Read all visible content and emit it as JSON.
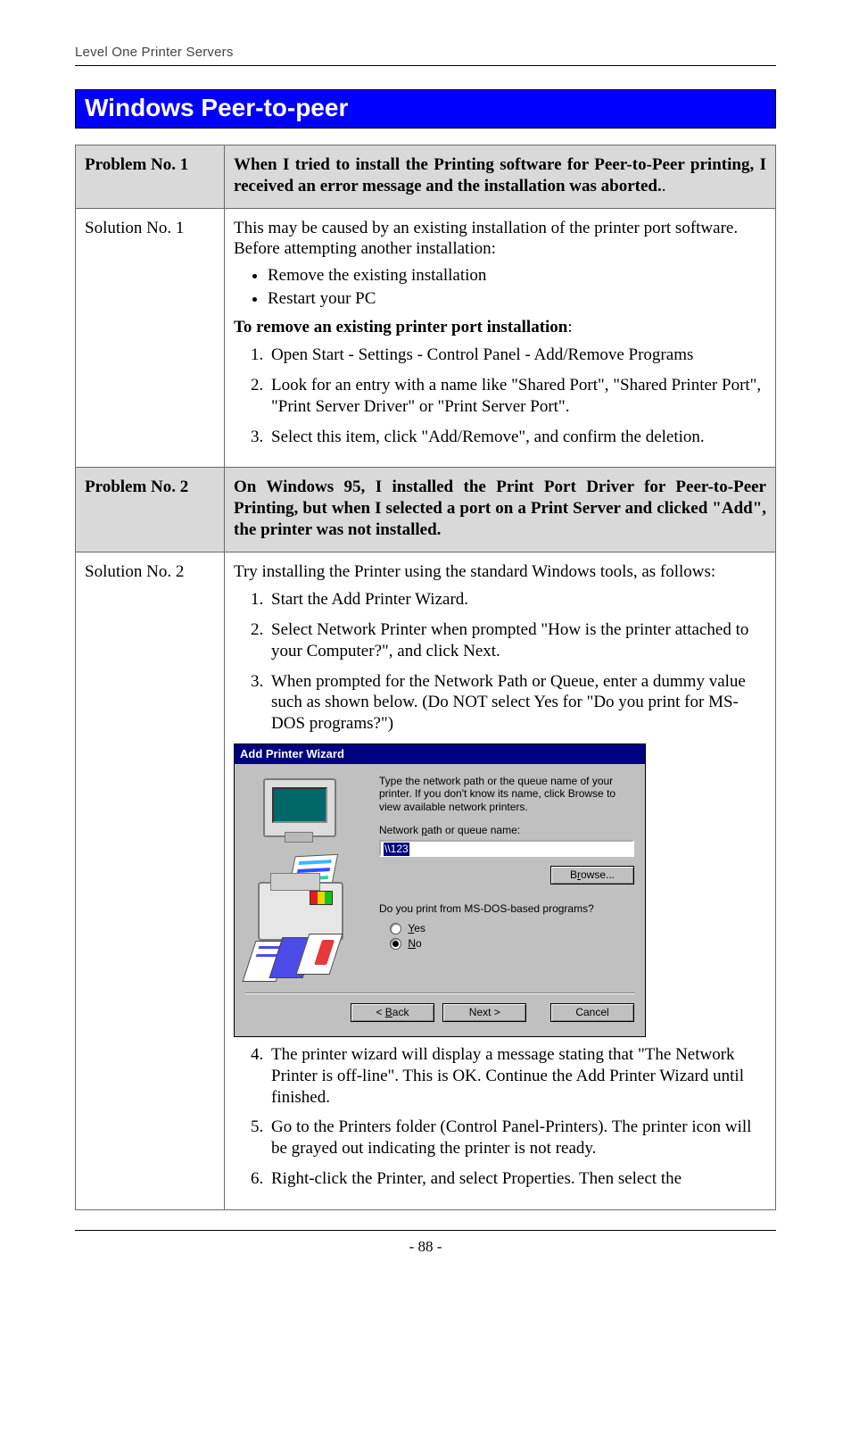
{
  "header": {
    "running": "Level One Printer Servers"
  },
  "section": {
    "title": "Windows Peer-to-peer"
  },
  "rows": {
    "p1": {
      "label": "Problem No. 1",
      "text_a": "When I tried to install the Printing software for Peer-to-Peer printing, I received an error message and the installation was aborted.",
      "text_b": "."
    },
    "s1": {
      "label": "Solution No. 1",
      "intro": "This may be caused by an existing installation of the printer port software. Before attempting another installation:",
      "bullets": [
        "Remove the existing installation",
        "Restart your PC"
      ],
      "subhead_a": "To remove an existing printer port installation",
      "subhead_b": ":",
      "steps": [
        "Open Start - Settings - Control Panel - Add/Remove Programs",
        "Look for an entry with a name like \"Shared Port\", \"Shared Printer Port\", \"Print Server Driver\" or \"Print Server Port\".",
        "Select this item, click \"Add/Remove\", and confirm the deletion."
      ]
    },
    "p2": {
      "label": "Problem No. 2",
      "text": "On Windows 95, I installed the Print Port Driver for Peer-to-Peer Printing, but when I selected a port on a Print Server and clicked \"Add\", the printer was not installed."
    },
    "s2": {
      "label": "Solution No. 2",
      "intro": "Try installing the Printer using the standard Windows tools, as follows:",
      "steps_before": [
        "Start the Add Printer Wizard.",
        "Select Network Printer when prompted \"How is the printer attached to your Computer?\", and click Next.",
        "When prompted for the Network Path or Queue, enter a dummy value such as shown below. (Do NOT select Yes for \"Do you print for MS-DOS programs?\")"
      ],
      "steps_after": [
        "The printer wizard will display a message stating that \"The Network Printer is off-line\". This is OK. Continue the Add Printer Wizard until finished.",
        "Go to the Printers folder (Control Panel-Printers). The printer icon will be grayed out indicating the printer is not ready.",
        "Right-click the Printer, and select Properties. Then select the"
      ]
    }
  },
  "dialog": {
    "title": "Add Printer Wizard",
    "instruction": "Type the network path or the queue name of your printer. If you don't know its name, click Browse to view available network printers.",
    "path_label_pre": "Network ",
    "path_label_u": "p",
    "path_label_post": "ath or queue name:",
    "path_value": "\\\\123",
    "browse_pre": "B",
    "browse_u": "r",
    "browse_post": "owse...",
    "question": "Do you print from MS-DOS-based programs?",
    "yes_u": "Y",
    "yes_post": "es",
    "no_u": "N",
    "no_post": "o",
    "back_pre": "< ",
    "back_u": "B",
    "back_post": "ack",
    "next": "Next >",
    "cancel": "Cancel"
  },
  "footer": {
    "page": "- 88 -"
  }
}
